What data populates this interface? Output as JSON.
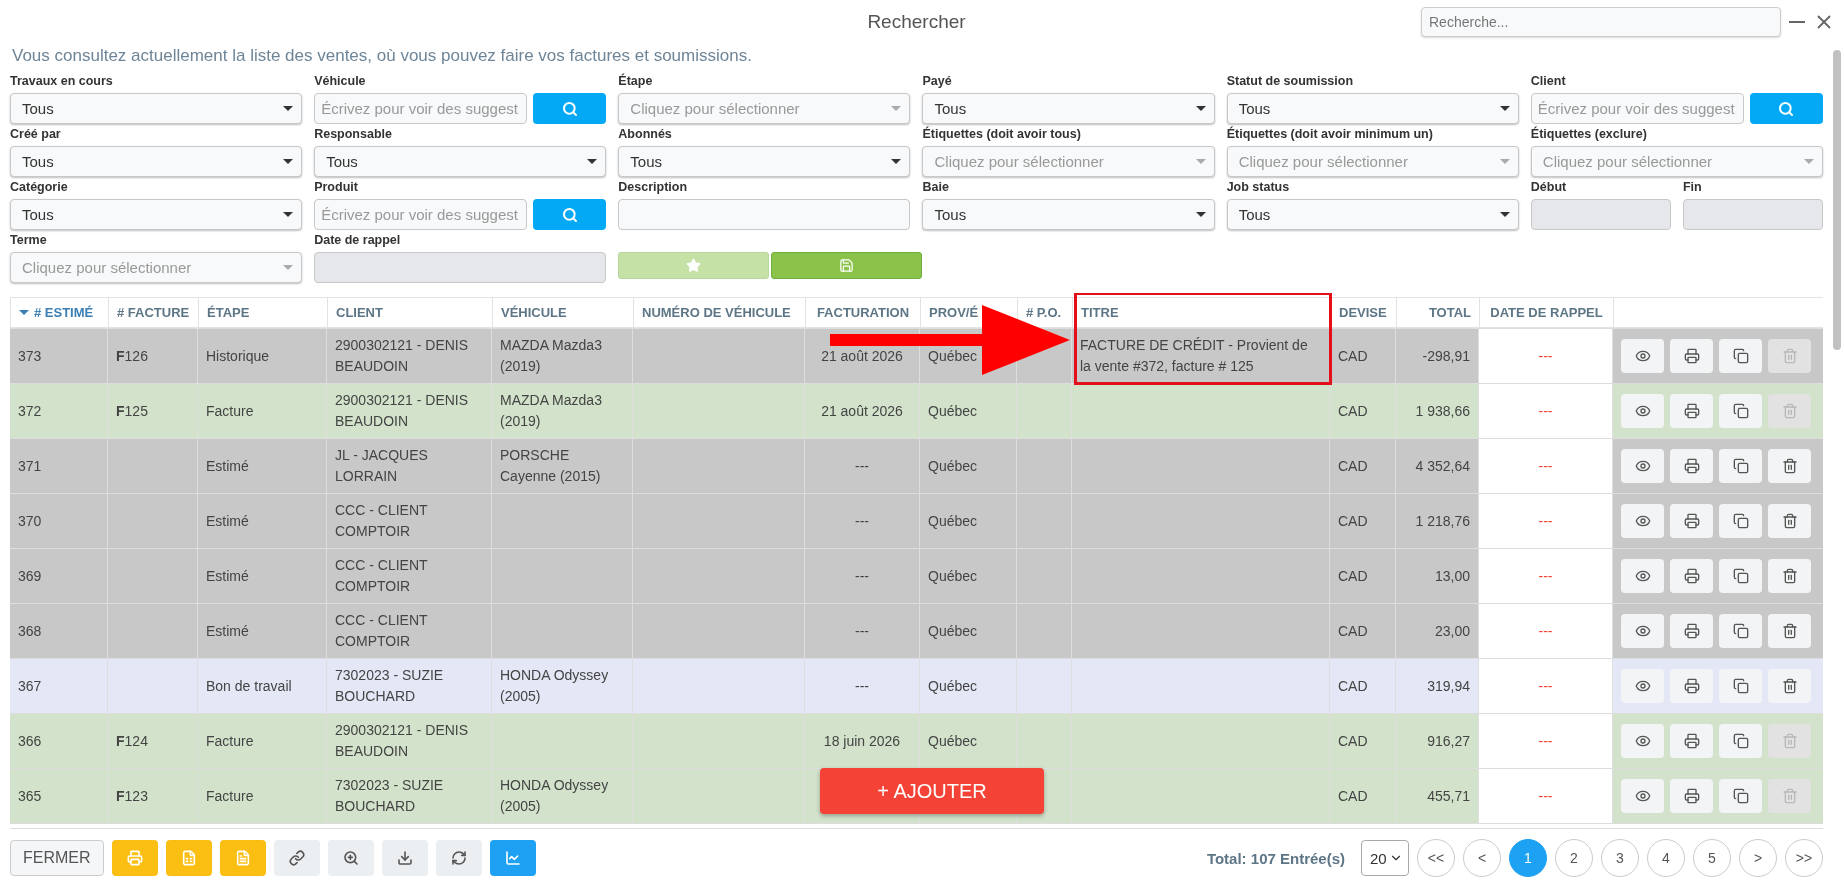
{
  "window": {
    "title": "Rechercher",
    "search_placeholder": "Recherche..."
  },
  "intro": "Vous consultez actuellement la liste des ventes, où vous pouvez faire vos factures et soumissions.",
  "filters": [
    {
      "label": "Travaux en cours",
      "kind": "select",
      "value": "Tous"
    },
    {
      "label": "Véhicule",
      "kind": "search",
      "placeholder": "Écrivez pour voir des suggest"
    },
    {
      "label": "Étape",
      "kind": "select",
      "placeholder": "Cliquez pour sélectionner"
    },
    {
      "label": "Payé",
      "kind": "select",
      "value": "Tous"
    },
    {
      "label": "Statut de soumission",
      "kind": "select",
      "value": "Tous"
    },
    {
      "label": "Client",
      "kind": "search",
      "placeholder": "Écrivez pour voir des suggest"
    },
    {
      "label": "Créé par",
      "kind": "select",
      "value": "Tous"
    },
    {
      "label": "Responsable",
      "kind": "select",
      "value": "Tous"
    },
    {
      "label": "Abonnés",
      "kind": "select",
      "value": "Tous"
    },
    {
      "label": "Étiquettes (doit avoir tous)",
      "kind": "select",
      "placeholder": "Cliquez pour sélectionner"
    },
    {
      "label": "Étiquettes (doit avoir minimum un)",
      "kind": "select",
      "placeholder": "Cliquez pour sélectionner"
    },
    {
      "label": "Étiquettes (exclure)",
      "kind": "select",
      "placeholder": "Cliquez pour sélectionner"
    },
    {
      "label": "Catégorie",
      "kind": "select",
      "value": "Tous"
    },
    {
      "label": "Produit",
      "kind": "search",
      "placeholder": "Écrivez pour voir des suggest"
    },
    {
      "label": "Description",
      "kind": "text"
    },
    {
      "label": "Baie",
      "kind": "select",
      "value": "Tous"
    },
    {
      "label": "Job status",
      "kind": "select",
      "value": "Tous"
    },
    {
      "label": "Début",
      "kind": "date",
      "half": true
    },
    {
      "label": "Fin",
      "kind": "date",
      "half": true
    },
    {
      "label": "Terme",
      "kind": "select",
      "placeholder": "Cliquez pour sélectionner"
    },
    {
      "label": "Date de rappel",
      "kind": "date"
    },
    {
      "kind": "actions"
    }
  ],
  "columns": [
    {
      "label": "# ESTIMÉ",
      "sorted": true
    },
    {
      "label": "# FACTURE",
      "sorted": false
    },
    {
      "label": "ÉTAPE",
      "sorted": false
    },
    {
      "label": "CLIENT",
      "sorted": false
    },
    {
      "label": "VÉHICULE",
      "sorted": false
    },
    {
      "label": "NUMÉRO DE VÉHICULE",
      "sorted": false
    },
    {
      "label": "FACTURATION",
      "sorted": false,
      "kind": "date"
    },
    {
      "label": "PROV/É",
      "sorted": false
    },
    {
      "label": "# P.O.",
      "sorted": false
    },
    {
      "label": "TITRE",
      "sorted": false
    },
    {
      "label": "DEVISE",
      "sorted": false
    },
    {
      "label": "TOTAL",
      "sorted": false,
      "kind": "amount"
    },
    {
      "label": "DATE DE RAPPEL",
      "sorted": false,
      "kind": "reminder"
    }
  ],
  "rows": [
    {
      "color": "#c8c8c8",
      "annotated": true,
      "delete_disabled": true,
      "cells": [
        "373",
        "**F**126",
        "Historique",
        "2900302121 - DENIS BEAUDOIN",
        "MAZDA Mazda3 (2019)",
        null,
        "21 août 2026",
        "Québec",
        null,
        "FACTURE DE CRÉDIT - Provient de la vente #372, facture # 125",
        "CAD",
        "-298,91",
        "---"
      ]
    },
    {
      "color": "#d3e3cb",
      "annotated": false,
      "delete_disabled": true,
      "cells": [
        "372",
        "**F**125",
        "Facture",
        "2900302121 - DENIS BEAUDOIN",
        "MAZDA Mazda3 (2019)",
        null,
        "21 août 2026",
        "Québec",
        null,
        null,
        "CAD",
        "1 938,66",
        "---"
      ]
    },
    {
      "color": "#c8c8c8",
      "annotated": false,
      "delete_disabled": false,
      "cells": [
        "371",
        null,
        "Estimé",
        "JL - JACQUES LORRAIN",
        "PORSCHE Cayenne (2015)",
        null,
        "---",
        "Québec",
        null,
        null,
        "CAD",
        "4 352,64",
        "---"
      ]
    },
    {
      "color": "#c8c8c8",
      "annotated": false,
      "delete_disabled": false,
      "cells": [
        "370",
        null,
        "Estimé",
        "CCC - CLIENT COMPTOIR",
        null,
        null,
        "---",
        "Québec",
        null,
        null,
        "CAD",
        "1 218,76",
        "---"
      ]
    },
    {
      "color": "#c8c8c8",
      "annotated": false,
      "delete_disabled": false,
      "cells": [
        "369",
        null,
        "Estimé",
        "CCC - CLIENT COMPTOIR",
        null,
        null,
        "---",
        "Québec",
        null,
        null,
        "CAD",
        "13,00",
        "---"
      ]
    },
    {
      "color": "#c8c8c8",
      "annotated": false,
      "delete_disabled": false,
      "cells": [
        "368",
        null,
        "Estimé",
        "CCC - CLIENT COMPTOIR",
        null,
        null,
        "---",
        "Québec",
        null,
        null,
        "CAD",
        "23,00",
        "---"
      ]
    },
    {
      "color": "#e4e8f6",
      "annotated": false,
      "delete_disabled": false,
      "cells": [
        "367",
        null,
        "Bon de travail",
        "7302023 - SUZIE BOUCHARD",
        "HONDA Odyssey (2005)",
        null,
        "---",
        "Québec",
        null,
        null,
        "CAD",
        "319,94",
        "---"
      ]
    },
    {
      "color": "#d3e3cb",
      "annotated": false,
      "delete_disabled": true,
      "cells": [
        "366",
        "**F**124",
        "Facture",
        "2900302121 - DENIS BEAUDOIN",
        null,
        null,
        "18 juin 2026",
        "Québec",
        null,
        null,
        "CAD",
        "916,27",
        "---"
      ]
    },
    {
      "color": "#d3e3cb",
      "annotated": false,
      "delete_disabled": true,
      "cells": [
        "365",
        "**F**123",
        "Facture",
        "7302023 - SUZIE BOUCHARD",
        "HONDA Odyssey (2005)",
        null,
        null,
        null,
        null,
        null,
        "CAD",
        "455,71",
        "---"
      ]
    }
  ],
  "add_button": "+ AJOUTER",
  "footer": {
    "close": "FERMER",
    "tools": [
      {
        "kind": "print",
        "color": "#fbbf14"
      },
      {
        "kind": "excel",
        "color": "#fbbf14"
      },
      {
        "kind": "pdf",
        "color": "#fbbf14"
      },
      {
        "kind": "link",
        "color": "#eceff1"
      },
      {
        "kind": "zoom",
        "color": "#eceff1"
      },
      {
        "kind": "download",
        "color": "#eceff1"
      },
      {
        "kind": "refresh",
        "color": "#eceff1"
      },
      {
        "kind": "chart",
        "color": "#1ea1f2"
      }
    ],
    "total": "Total: 107 Entrée(s)",
    "page_size": "20",
    "pages": [
      {
        "label": "<<",
        "selected": false
      },
      {
        "label": "<",
        "selected": false
      },
      {
        "label": "1",
        "selected": true
      },
      {
        "label": "2",
        "selected": false
      },
      {
        "label": "3",
        "selected": false
      },
      {
        "label": "4",
        "selected": false
      },
      {
        "label": "5",
        "selected": false
      },
      {
        "label": ">",
        "selected": false
      },
      {
        "label": ">>",
        "selected": false
      }
    ]
  }
}
